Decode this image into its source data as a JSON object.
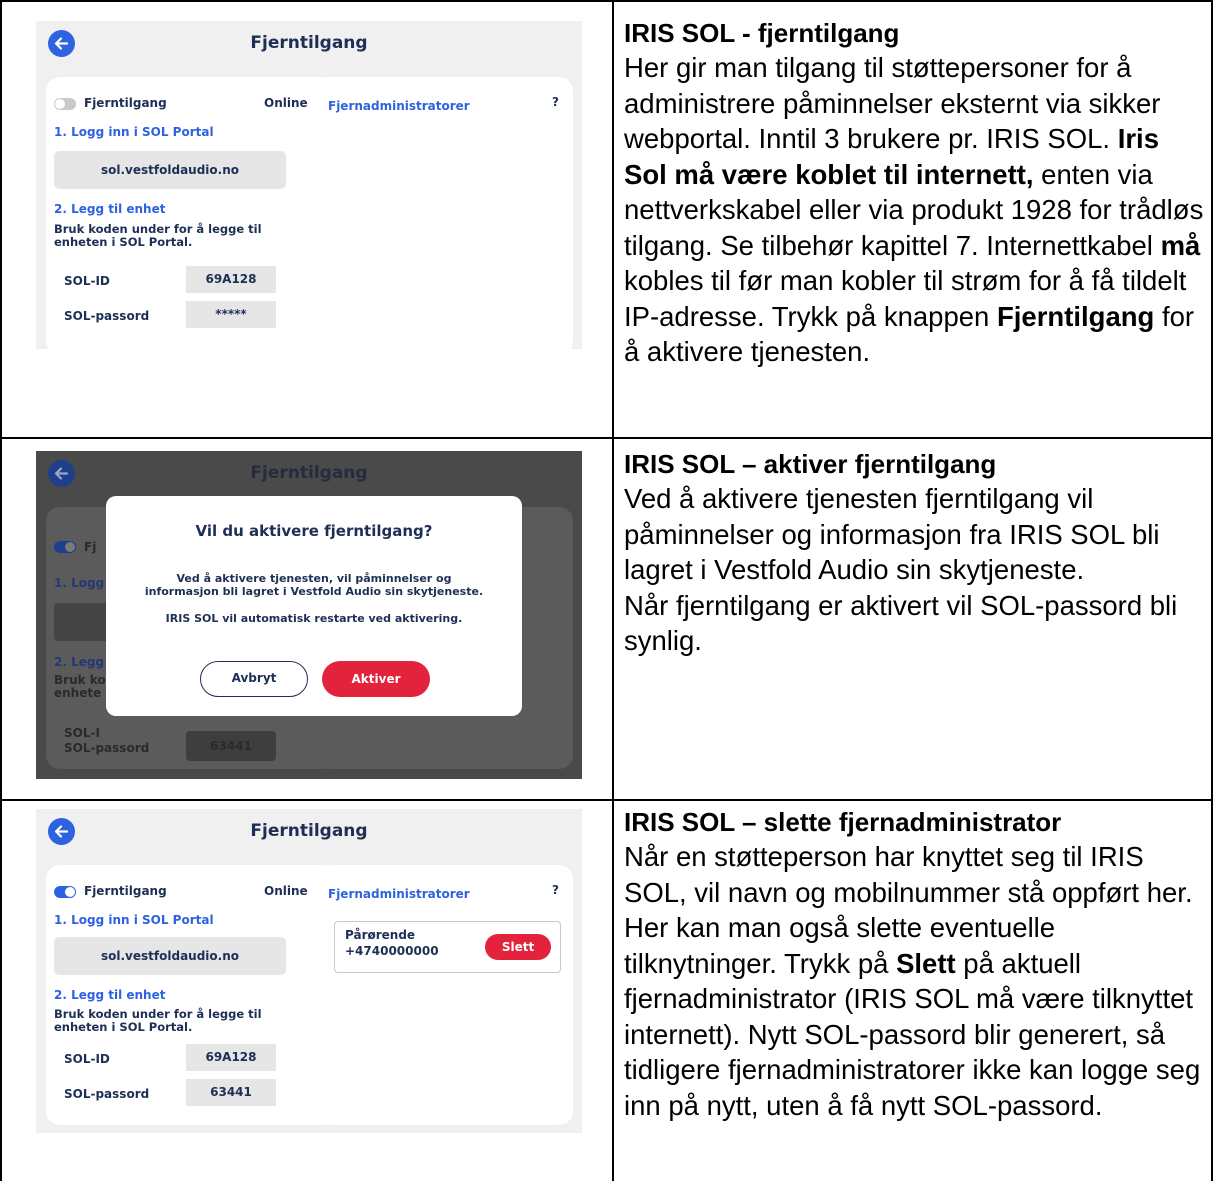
{
  "screens": {
    "header_title": "Fjerntilgang",
    "toggle_label": "Fjerntilgang",
    "status": "Online",
    "step1": "1. Logg inn i SOL Portal",
    "portal_url": "sol.vestfoldaudio.no",
    "step2": "2. Legg til enhet",
    "hint_line1": "Bruk koden under for å legge til",
    "hint_line2": "enheten i SOL Portal.",
    "sol_id_label": "SOL-ID",
    "sol_id_value": "69A128",
    "sol_pw_label": "SOL-passord",
    "sol_pw_hidden": "*****",
    "sol_pw_value": "63441",
    "remote_admins_title": "Fjernadministratorer",
    "help": "?",
    "toggle_off": "off",
    "toggle_on": "on",
    "dim_partial": {
      "step1": "1. Logg",
      "step2": "2. Legg",
      "hint1": "Bruk kod",
      "hint2": "enhete",
      "toggle": "Fj",
      "sol_id": "SOL-I"
    }
  },
  "modal": {
    "title": "Vil du aktivere fjerntilgang?",
    "text1": "Ved å aktivere tjenesten, vil påminnelser og",
    "text2": "informasjon bli lagret i Vestfold Audio sin skytjeneste.",
    "text3": "IRIS SOL vil automatisk restarte ved aktivering.",
    "cancel": "Avbryt",
    "activate": "Aktiver"
  },
  "admin": {
    "name": "Pårørende",
    "phone": "+4740000000",
    "delete": "Slett"
  },
  "descriptions": {
    "row1": {
      "heading": "IRIS SOL - fjerntilgang",
      "t1": "Her gir man tilgang til støttepersoner for å administrere påminnelser eksternt via sikker webportal. Inntil 3 brukere pr. IRIS SOL. ",
      "b1": "Iris Sol må være koblet til internett,",
      "t2": " enten via nettverkskabel eller via produkt 1928 for trådløs tilgang. Se tilbehør kapittel 7. Internettkabel ",
      "b2": "må",
      "t3": " kobles til før man kobler til strøm for å få tildelt IP-adresse. Trykk på knappen ",
      "b3": "Fjerntilgang",
      "t4": " for å aktivere tjenesten."
    },
    "row2": {
      "heading": "IRIS SOL – aktiver fjerntilgang",
      "t1": "Ved å aktivere tjenesten fjerntilgang vil påminnelser og informasjon fra IRIS SOL bli lagret i Vestfold Audio sin skytjeneste.",
      "t2": "Når fjerntilgang er aktivert vil SOL-passord bli synlig."
    },
    "row3": {
      "heading": "IRIS SOL – slette fjernadministrator",
      "t1": "Når en støtteperson har knyttet seg til IRIS SOL, vil navn og mobilnummer stå oppført her. Her kan man også slette eventuelle tilknytninger. Trykk på ",
      "b1": "Slett",
      "t2": " på aktuell fjernadministrator (IRIS SOL må være tilknyttet internett). Nytt SOL-passord blir generert, så tidligere fjernadministratorer ikke kan logge seg inn på nytt, uten å få nytt SOL-passord."
    }
  },
  "colors": {
    "primary_blue": "#2d62e0",
    "navy_text": "#1e2f55",
    "red": "#e2233b",
    "panel_bg": "#f0f0f0"
  }
}
